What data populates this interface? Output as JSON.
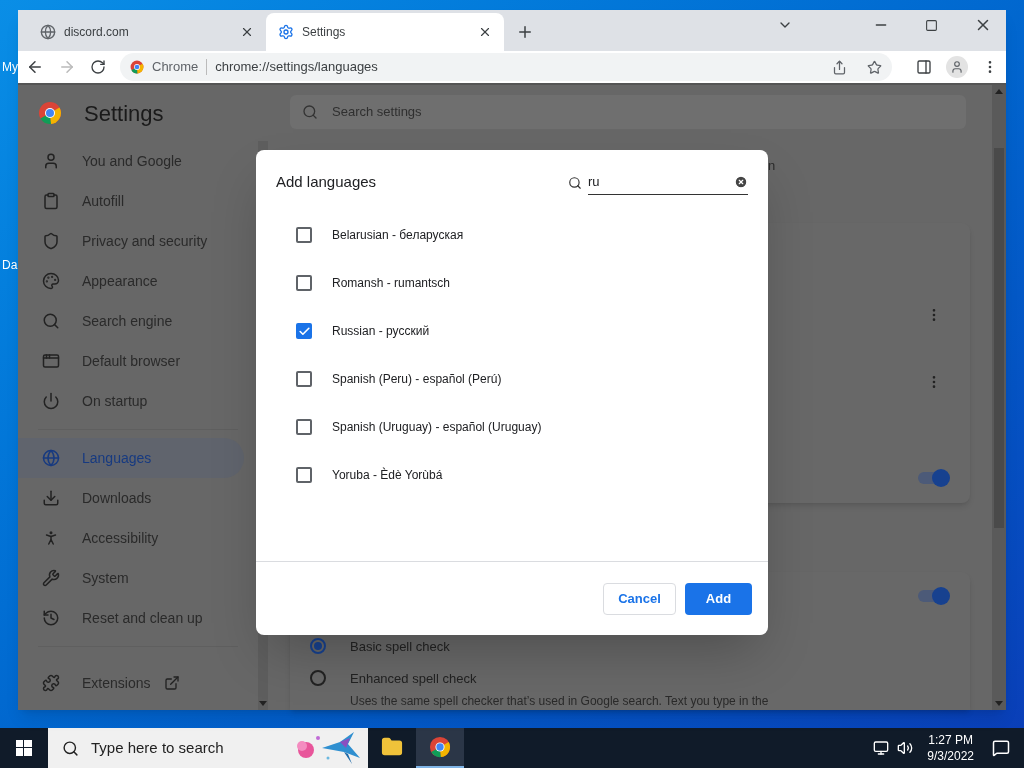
{
  "desktop": {
    "icon_labels": [
      "My",
      "Da"
    ]
  },
  "browser": {
    "tabs": [
      {
        "title": "discord.com",
        "selected": false
      },
      {
        "title": "Settings",
        "selected": true
      }
    ],
    "address": {
      "origin": "Chrome",
      "url": "chrome://settings/languages"
    }
  },
  "settings": {
    "title": "Settings",
    "search_placeholder": "Search settings",
    "nav": [
      {
        "label": "You and Google",
        "selected": false
      },
      {
        "label": "Autofill",
        "selected": false
      },
      {
        "label": "Privacy and security",
        "selected": false
      },
      {
        "label": "Appearance",
        "selected": false
      },
      {
        "label": "Search engine",
        "selected": false
      },
      {
        "label": "Default browser",
        "selected": false
      },
      {
        "label": "On startup",
        "selected": false
      },
      {
        "label": "Languages",
        "selected": true
      },
      {
        "label": "Downloads",
        "selected": false
      },
      {
        "label": "Accessibility",
        "selected": false
      },
      {
        "label": "System",
        "selected": false
      },
      {
        "label": "Reset and clean up",
        "selected": false
      },
      {
        "label": "Extensions",
        "selected": false
      }
    ],
    "fragment": "n",
    "toggles": [
      {
        "on": true
      },
      {
        "on": true
      }
    ],
    "spell_check": [
      {
        "label": "Basic spell check",
        "selected": true
      },
      {
        "label": "Enhanced spell check",
        "selected": false,
        "description": "Uses the same spell checker that’s used in Google search. Text you type in the"
      }
    ]
  },
  "dialog": {
    "title": "Add languages",
    "search_value": "ru",
    "languages": [
      {
        "label": "Belarusian - беларуская",
        "checked": false
      },
      {
        "label": "Romansh - rumantsch",
        "checked": false
      },
      {
        "label": "Russian - русский",
        "checked": true
      },
      {
        "label": "Spanish (Peru) - español (Perú)",
        "checked": false
      },
      {
        "label": "Spanish (Uruguay) - español (Uruguay)",
        "checked": false
      },
      {
        "label": "Yoruba - Èdè Yorùbá",
        "checked": false
      }
    ],
    "buttons": [
      {
        "label": "Cancel",
        "kind": "secondary"
      },
      {
        "label": "Add",
        "kind": "primary"
      }
    ]
  },
  "taskbar": {
    "search_placeholder": "Type here to search",
    "apps": [
      {
        "kind": "explorer",
        "selected": false
      },
      {
        "kind": "chrome",
        "selected": true
      }
    ],
    "time": "1:27 PM",
    "date": "9/3/2022"
  }
}
